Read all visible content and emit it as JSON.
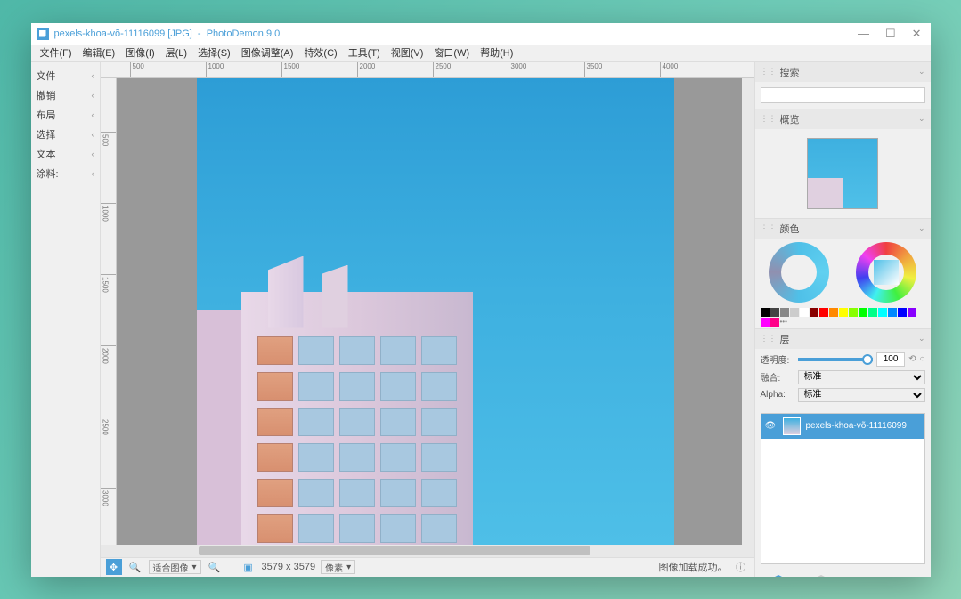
{
  "titlebar": {
    "filename": "pexels-khoa-võ-11116099 [JPG]",
    "app": "PhotoDemon 9.0"
  },
  "menubar": [
    "文件(F)",
    "编辑(E)",
    "图像(I)",
    "层(L)",
    "选择(S)",
    "图像调整(A)",
    "特效(C)",
    "工具(T)",
    "视图(V)",
    "窗口(W)",
    "帮助(H)"
  ],
  "toolbar": {
    "items": [
      "文件",
      "撤销",
      "布局",
      "选择",
      "文本",
      "涂料:"
    ]
  },
  "ruler_h": [
    "500",
    "1000",
    "1500",
    "2000",
    "2500",
    "3000",
    "3500",
    "4000"
  ],
  "ruler_v": [
    "500",
    "1000",
    "1500",
    "2000",
    "2500",
    "3000"
  ],
  "panels": {
    "search": {
      "title": "搜索",
      "placeholder": ""
    },
    "overview": {
      "title": "概览"
    },
    "color": {
      "title": "颜色"
    },
    "layers": {
      "title": "层",
      "opacity_label": "透明度:",
      "opacity_value": "100",
      "blend_label": "融合:",
      "blend_value": "标准",
      "alpha_label": "Alpha:",
      "alpha_value": "标准",
      "layer_name": "pexels-khoa-võ-11116099"
    }
  },
  "swatches": [
    "#000",
    "#444",
    "#888",
    "#ccc",
    "#fff",
    "#800",
    "#f00",
    "#f80",
    "#ff0",
    "#8f0",
    "#0f0",
    "#0f8",
    "#0ff",
    "#08f",
    "#00f",
    "#80f",
    "#f0f",
    "#f08"
  ],
  "statusbar": {
    "zoom_fit": "适合图像",
    "dimensions": "3579 x 3579",
    "unit": "像素",
    "status_text": "图像加载成功。"
  }
}
